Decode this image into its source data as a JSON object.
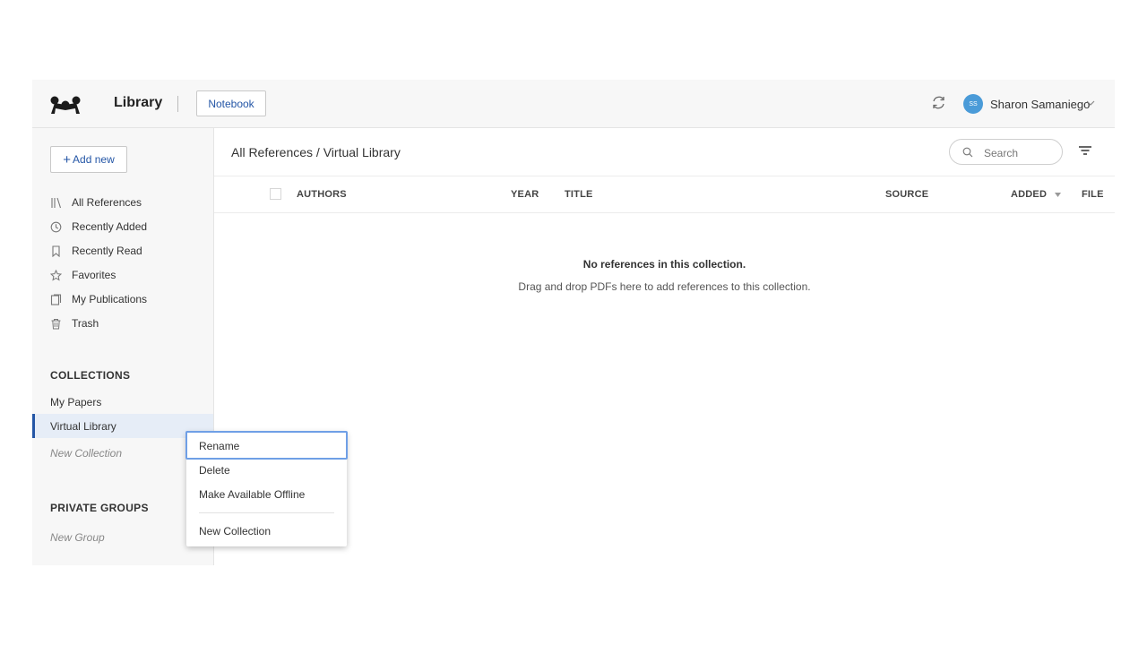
{
  "header": {
    "library_title": "Library",
    "notebook_label": "Notebook",
    "user_initials": "SS",
    "user_name": "Sharon Samaniego",
    "icons": [
      "mendeley-logo-icon",
      "sync-icon",
      "chevron-down-icon"
    ]
  },
  "sidebar": {
    "add_new_label": "Add new",
    "nav": [
      {
        "label": "All References",
        "icon": "library-icon"
      },
      {
        "label": "Recently Added",
        "icon": "clock-icon"
      },
      {
        "label": "Recently Read",
        "icon": "bookmark-icon"
      },
      {
        "label": "Favorites",
        "icon": "star-icon"
      },
      {
        "label": "My Publications",
        "icon": "publications-icon"
      },
      {
        "label": "Trash",
        "icon": "trash-icon"
      }
    ],
    "collections_heading": "COLLECTIONS",
    "collections": [
      "My Papers",
      "Virtual Library"
    ],
    "selected_collection": "Virtual Library",
    "new_collection_label": "New Collection",
    "private_groups_heading": "PRIVATE GROUPS",
    "new_group_label": "New Group"
  },
  "main": {
    "breadcrumb": "All References / Virtual Library",
    "search_placeholder": "Search",
    "columns": {
      "authors": "AUTHORS",
      "year": "YEAR",
      "title": "TITLE",
      "source": "SOURCE",
      "added": "ADDED",
      "file": "FILE"
    },
    "empty_title": "No references in this collection.",
    "empty_subtitle": "Drag and drop PDFs here to add references to this collection."
  },
  "context_menu": {
    "items": [
      "Rename",
      "Delete",
      "Make Available Offline",
      "New Collection"
    ],
    "focused": "Rename"
  },
  "colors": {
    "accent": "#2456a6",
    "avatar": "#4a9bd8",
    "selected_bg": "#e6edf7",
    "focus_ring": "#6f9fe6"
  }
}
